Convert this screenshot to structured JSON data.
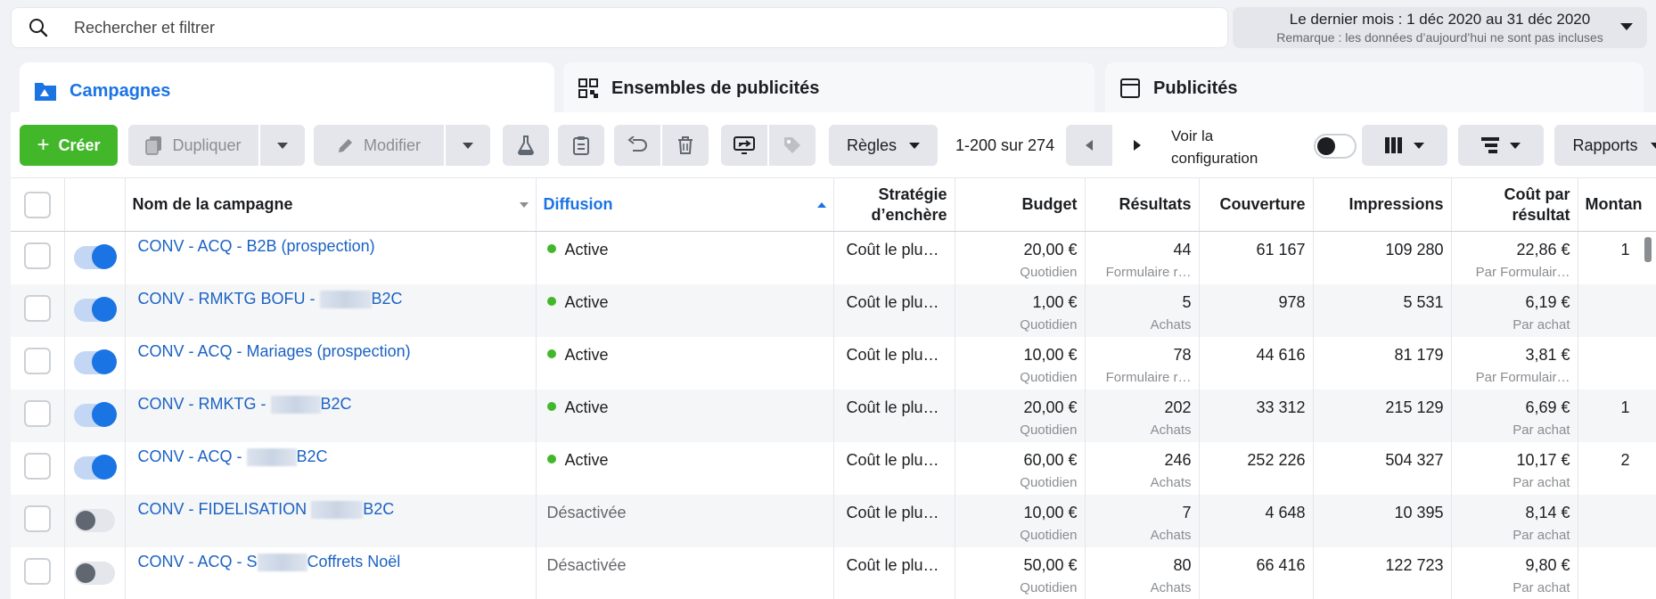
{
  "search": {
    "placeholder": "Rechercher et filtrer"
  },
  "date_range": {
    "label": "Le dernier mois : 1 déc 2020 au 31 déc 2020",
    "note": "Remarque : les données d’aujourd’hui ne sont pas incluses"
  },
  "tabs": [
    {
      "label": "Campagnes"
    },
    {
      "label": "Ensembles de publicités"
    },
    {
      "label": "Publicités"
    }
  ],
  "toolbar": {
    "create": "Créer",
    "duplicate": "Dupliquer",
    "modify": "Modifier",
    "rules": "Règles",
    "pagination": "1-200 sur 274",
    "config_line1": "Voir la",
    "config_line2": "configuration",
    "reports": "Rapports"
  },
  "columns": {
    "name": "Nom de la campagne",
    "delivery": "Diffusion",
    "strategy_1": "Stratégie",
    "strategy_2": "d’enchère",
    "budget": "Budget",
    "results": "Résultats",
    "reach": "Couverture",
    "impressions": "Impressions",
    "cpr_1": "Coût par",
    "cpr_2": "résultat",
    "amount": "Montan"
  },
  "rows": [
    {
      "name_prefix": "CONV - ACQ - B2B (prospection)",
      "name_suffix": "",
      "active": true,
      "delivery": "Active",
      "strategy": "Coût le plu…",
      "budget": "20,00 €",
      "budget_sub": "Quotidien",
      "results": "44",
      "results_sub": "Formulaire r…",
      "reach": "61 167",
      "impressions": "109 280",
      "cpr": "22,86 €",
      "cpr_sub": "Par Formulair…",
      "amount": "1"
    },
    {
      "name_prefix": "CONV - RMKTG BOFU - ",
      "name_suffix": "B2C",
      "active": true,
      "delivery": "Active",
      "strategy": "Coût le plu…",
      "budget": "1,00 €",
      "budget_sub": "Quotidien",
      "results": "5",
      "results_sub": "Achats",
      "reach": "978",
      "impressions": "5 531",
      "cpr": "6,19 €",
      "cpr_sub": "Par achat",
      "amount": ""
    },
    {
      "name_prefix": "CONV - ACQ - Mariages (prospection)",
      "name_suffix": "",
      "active": true,
      "delivery": "Active",
      "strategy": "Coût le plu…",
      "budget": "10,00 €",
      "budget_sub": "Quotidien",
      "results": "78",
      "results_sub": "Formulaire r…",
      "reach": "44 616",
      "impressions": "81 179",
      "cpr": "3,81 €",
      "cpr_sub": "Par Formulair…",
      "amount": ""
    },
    {
      "name_prefix": "CONV - RMKTG - ",
      "name_suffix": "B2C",
      "active": true,
      "delivery": "Active",
      "strategy": "Coût le plu…",
      "budget": "20,00 €",
      "budget_sub": "Quotidien",
      "results": "202",
      "results_sub": "Achats",
      "reach": "33 312",
      "impressions": "215 129",
      "cpr": "6,69 €",
      "cpr_sub": "Par achat",
      "amount": "1"
    },
    {
      "name_prefix": "CONV - ACQ - ",
      "name_suffix": "B2C",
      "active": true,
      "delivery": "Active",
      "strategy": "Coût le plu…",
      "budget": "60,00 €",
      "budget_sub": "Quotidien",
      "results": "246",
      "results_sub": "Achats",
      "reach": "252 226",
      "impressions": "504 327",
      "cpr": "10,17 €",
      "cpr_sub": "Par achat",
      "amount": "2"
    },
    {
      "name_prefix": "CONV - FIDELISATION ",
      "name_suffix": "B2C",
      "active": false,
      "delivery": "Désactivée",
      "strategy": "Coût le plu…",
      "budget": "10,00 €",
      "budget_sub": "Quotidien",
      "results": "7",
      "results_sub": "Achats",
      "reach": "4 648",
      "impressions": "10 395",
      "cpr": "8,14 €",
      "cpr_sub": "Par achat",
      "amount": ""
    },
    {
      "name_prefix": "CONV - ACQ - S",
      "name_suffix": "Coffrets Noël",
      "active": false,
      "delivery": "Désactivée",
      "strategy": "Coût le plu…",
      "budget": "50,00 €",
      "budget_sub": "Quotidien",
      "results": "80",
      "results_sub": "Achats",
      "reach": "66 416",
      "impressions": "122 723",
      "cpr": "9,80 €",
      "cpr_sub": "Par achat",
      "amount": ""
    }
  ],
  "colors": {
    "accent": "#1b74e4",
    "create": "#42b72a",
    "active_dot": "#42b72a"
  }
}
